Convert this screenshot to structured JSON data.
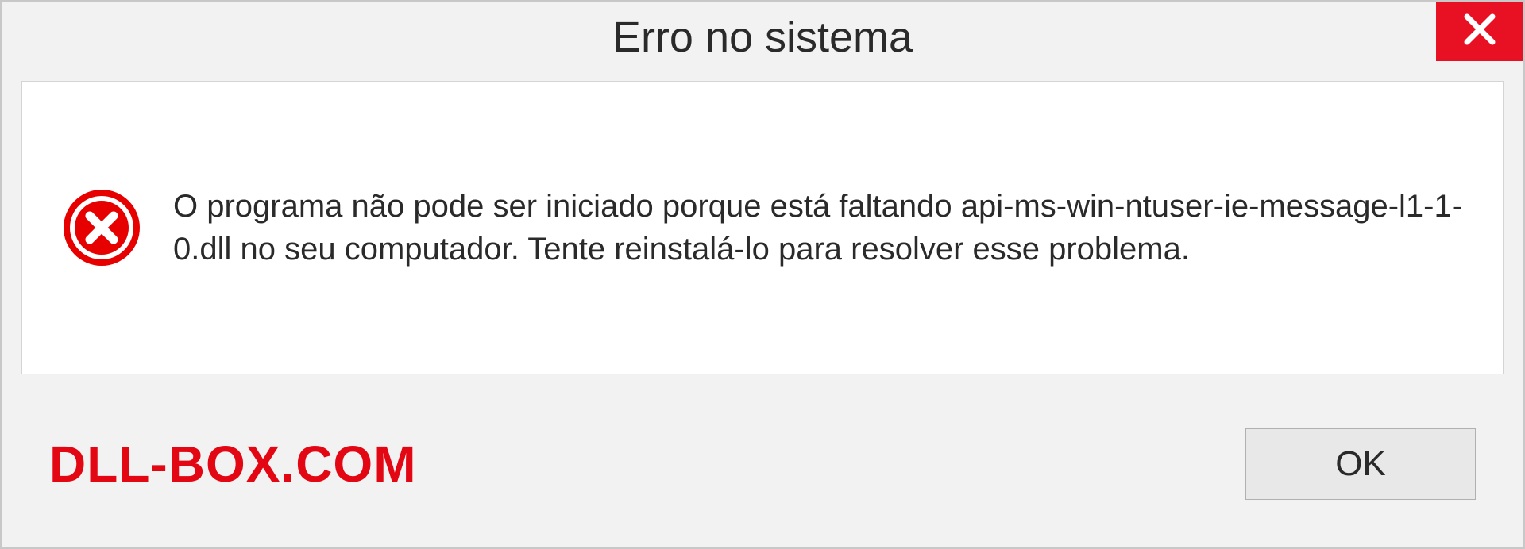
{
  "dialog": {
    "title": "Erro no sistema",
    "message": "O programa não pode ser iniciado porque está faltando api-ms-win-ntuser-ie-message-l1-1-0.dll no seu computador. Tente reinstalá-lo para resolver esse problema.",
    "ok_label": "OK"
  },
  "watermark": "DLL-BOX.COM"
}
